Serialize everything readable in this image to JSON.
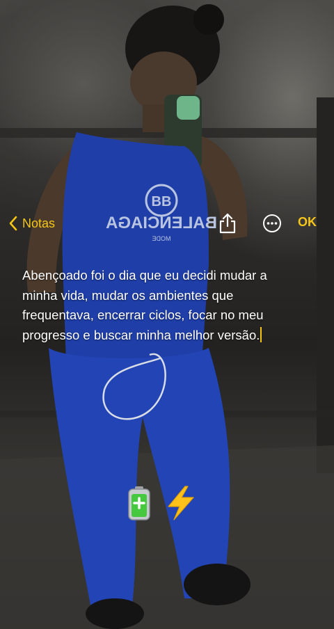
{
  "app": {
    "back_label": "Notas",
    "done_label": "OK"
  },
  "note": {
    "text": "Abençoado foi o dia que eu decidi mudar a minha vida, mudar os ambientes que frequentava, encerrar ciclos, focar no meu progresso e buscar minha melhor versão.",
    "emojis": [
      "battery-icon",
      "lightning-icon"
    ]
  },
  "background": {
    "shirt_print_line1": "BALENCIAGA",
    "shirt_print_line2": "MODE"
  },
  "colors": {
    "accent": "#f5c518",
    "text": "#ffffff",
    "outfit": "#1f3ea8"
  },
  "icons": {
    "back": "chevron-left-icon",
    "share": "share-icon",
    "more": "ellipsis-circle-icon"
  }
}
